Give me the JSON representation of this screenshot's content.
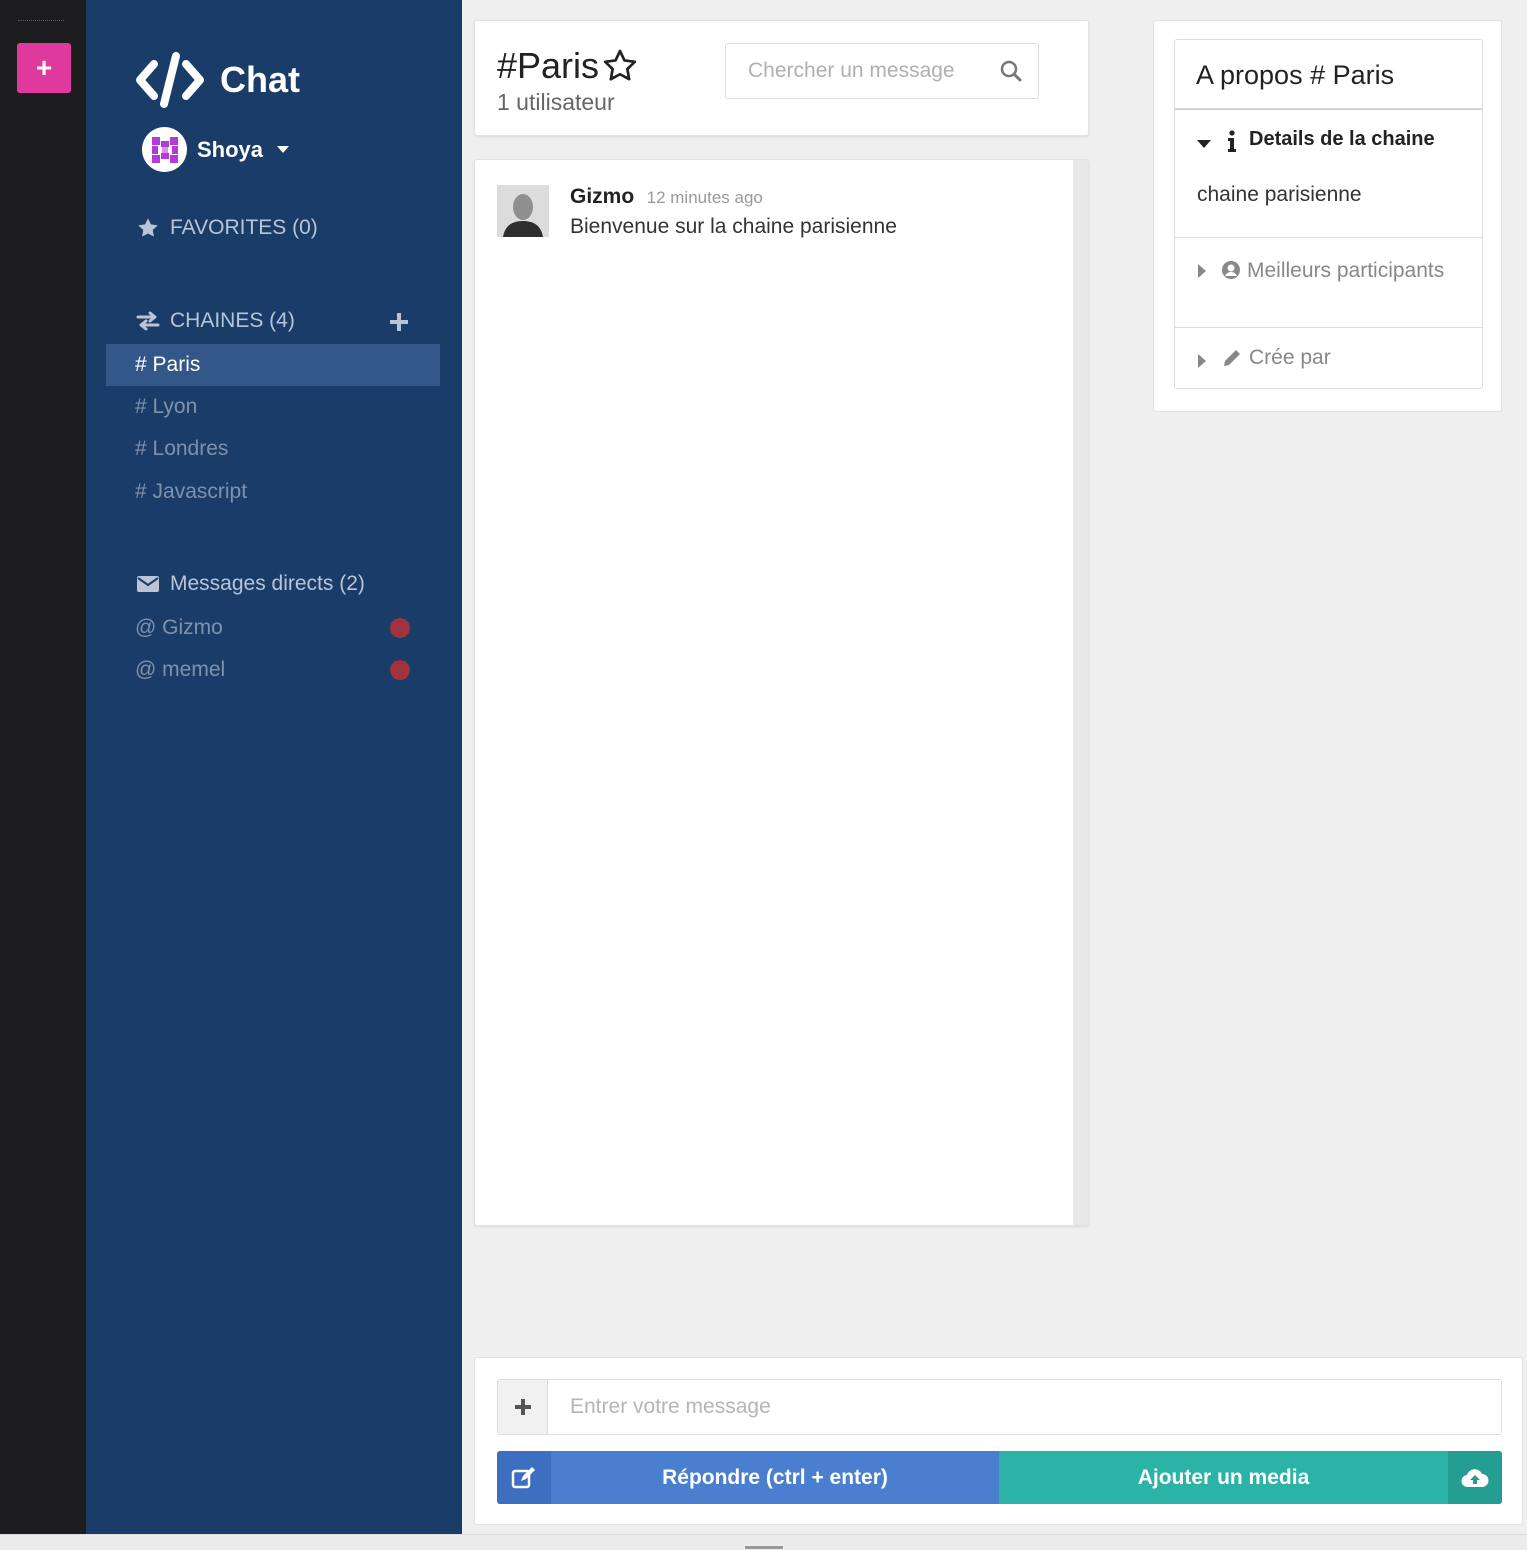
{
  "app": {
    "title": "Chat",
    "add_button": "+"
  },
  "user": {
    "name": "Shoya"
  },
  "sidebar": {
    "favorites_label": "FAVORITES (0)",
    "channels_label": "CHAINES (4)",
    "channels": [
      {
        "label": "# Paris",
        "active": true
      },
      {
        "label": "# Lyon",
        "active": false
      },
      {
        "label": "# Londres",
        "active": false
      },
      {
        "label": "# Javascript",
        "active": false
      }
    ],
    "direct_label": "Messages directs (2)",
    "direct": [
      {
        "label": "@ Gizmo",
        "status": "offline"
      },
      {
        "label": "@ memel",
        "status": "offline"
      }
    ]
  },
  "channel": {
    "name": "#Paris",
    "users": "1 utilisateur",
    "search_placeholder": "Chercher un message"
  },
  "messages": [
    {
      "author": "Gizmo",
      "time": "12 minutes ago",
      "text": "Bienvenue sur la chaine parisienne"
    }
  ],
  "about": {
    "title": "A propos # Paris",
    "details_label": "Details de la chaine",
    "details_text": "chaine parisienne",
    "top_label": "Meilleurs participants",
    "created_label": "Crée par"
  },
  "composer": {
    "placeholder": "Entrer votre message",
    "reply_label": "Répondre (ctrl + enter)",
    "media_label": "Ajouter un media"
  },
  "colors": {
    "rail": "#1d1d1f",
    "sidebar": "#1a3c69",
    "active_channel": "#34578a",
    "add_button": "#e0399e",
    "reply_button": "#4a7fd0",
    "media_button": "#2bb3a8",
    "status_dot": "#a0333d"
  }
}
